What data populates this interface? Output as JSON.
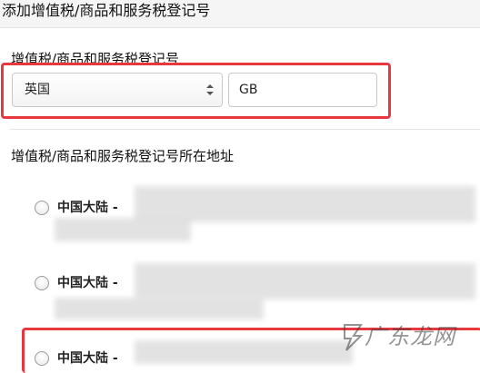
{
  "header": {
    "title": "添加增值税/商品和服务税登记号"
  },
  "vat_section": {
    "label": "增值税/商品和服务税登记号",
    "country_select": {
      "value": "英国"
    },
    "vat_number_input": {
      "value": "GB"
    }
  },
  "address_section": {
    "label": "增值税/商品和服务税登记号所在地址",
    "options": [
      {
        "label": "中国大陆 -",
        "selected": false
      },
      {
        "label": "中国大陆 -",
        "selected": false
      },
      {
        "label": "中国大陆 -",
        "selected": false
      }
    ]
  },
  "colors": {
    "highlight_border": "#e8383f",
    "header_background": "#f5f5f5"
  },
  "watermark": {
    "text": "广东龙网"
  }
}
